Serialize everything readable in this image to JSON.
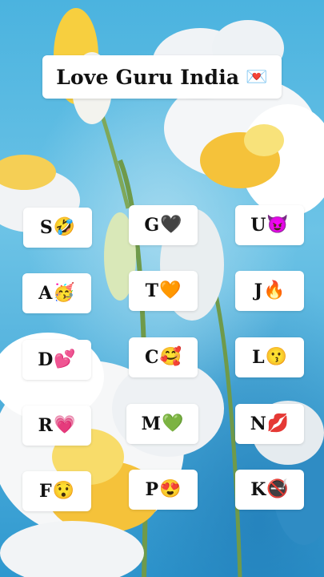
{
  "title": {
    "text": "Love Guru India",
    "emoji": "💌"
  },
  "cards": [
    {
      "letter": "S",
      "emoji": "🤣"
    },
    {
      "letter": "G",
      "emoji": "🖤"
    },
    {
      "letter": "U",
      "emoji": "😈"
    },
    {
      "letter": "A",
      "emoji": "🥳"
    },
    {
      "letter": "T",
      "emoji": "🧡"
    },
    {
      "letter": "J",
      "emoji": "🔥"
    },
    {
      "letter": "D",
      "emoji": "💕"
    },
    {
      "letter": "C",
      "emoji": "🥰"
    },
    {
      "letter": "L",
      "emoji": "😗"
    },
    {
      "letter": "R",
      "emoji": "💗"
    },
    {
      "letter": "M",
      "emoji": "💚"
    },
    {
      "letter": "N",
      "emoji": "💋"
    },
    {
      "letter": "F",
      "emoji": "😯"
    },
    {
      "letter": "P",
      "emoji": "😍"
    },
    {
      "letter": "K",
      "emoji": "🚭"
    }
  ]
}
